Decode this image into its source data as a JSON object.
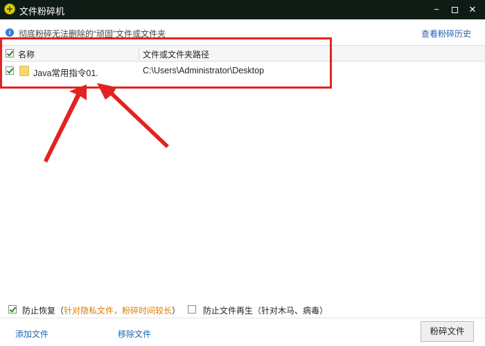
{
  "window": {
    "title": "文件粉碎机",
    "controls": {
      "minimize": "−",
      "close": "✕"
    }
  },
  "info": {
    "text": "彻底粉碎无法删除的“顽固”文件或文件夹",
    "history_link": "查看粉碎历史"
  },
  "table": {
    "columns": {
      "name": "名称",
      "path": "文件或文件夹路径"
    },
    "rows": [
      {
        "name": "Java常用指令01.",
        "path": "C:\\Users\\Administrator\\Desktop",
        "checked": true
      }
    ]
  },
  "options": {
    "prevent_recovery": {
      "label": "防止恢复",
      "note_open": "（",
      "note": "针对隐私文件，粉碎时间较长",
      "note_close": "）",
      "checked": true
    },
    "prevent_regen": {
      "label": "防止文件再生",
      "note": "（针对木马、病毒）",
      "checked": false
    }
  },
  "actions": {
    "add_file": "添加文件",
    "remove_file": "移除文件",
    "shred": "粉碎文件"
  },
  "colors": {
    "titlebar": "#0f1b15",
    "link": "#1f63b5",
    "annotation_red": "#e32222",
    "note_orange": "#e07b00"
  }
}
